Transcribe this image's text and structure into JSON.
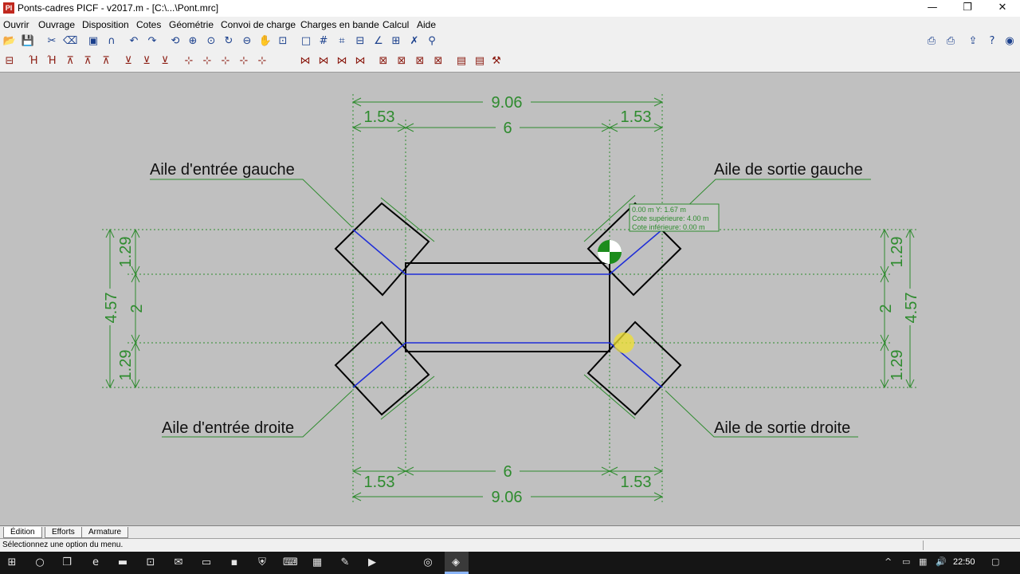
{
  "window": {
    "title": "Ponts-cadres PICF - v2017.m - [C:\\...\\Pont.mrc]",
    "app_icon": "PI",
    "minimize_glyph": "—",
    "restore_glyph": "❐",
    "close_glyph": "✕"
  },
  "menu": [
    "Ouvrir",
    "Ouvrage",
    "Disposition",
    "Cotes",
    "Géométrie",
    "Convoi de charge",
    "Charges en bande",
    "Calcul",
    "Aide"
  ],
  "toolbar1": [
    {
      "name": "open-folder-icon",
      "glyph": "📂"
    },
    {
      "name": "save-icon",
      "glyph": "💾"
    },
    {
      "name": "cut-icon",
      "glyph": "✂"
    },
    {
      "name": "erase-icon",
      "glyph": "⌫"
    },
    {
      "name": "properties-icon",
      "glyph": "▣"
    },
    {
      "name": "magnet-icon",
      "glyph": "∩"
    },
    {
      "name": "undo-icon",
      "glyph": "↶"
    },
    {
      "name": "redo-icon",
      "glyph": "↷"
    },
    {
      "name": "zoom-previous-icon",
      "glyph": "⟲"
    },
    {
      "name": "zoom-window-icon",
      "glyph": "⊕"
    },
    {
      "name": "zoom-in-icon",
      "glyph": "⊙"
    },
    {
      "name": "zoom-refresh-icon",
      "glyph": "↻"
    },
    {
      "name": "zoom-out-icon",
      "glyph": "⊖"
    },
    {
      "name": "pan-hand-icon",
      "glyph": "✋"
    },
    {
      "name": "zoom-extents-icon",
      "glyph": "⊡"
    },
    {
      "name": "frame-icon",
      "glyph": "□"
    },
    {
      "name": "grid-icon",
      "glyph": "#"
    },
    {
      "name": "snap-icon",
      "glyph": "⌗"
    },
    {
      "name": "dimension-icon",
      "glyph": "⊟"
    },
    {
      "name": "angle-icon",
      "glyph": "∠"
    },
    {
      "name": "layout-icon",
      "glyph": "⊞"
    },
    {
      "name": "tools-icon",
      "glyph": "✗"
    },
    {
      "name": "binoculars-icon",
      "glyph": "⚲"
    }
  ],
  "toolbar1_right": [
    {
      "name": "print-preview-icon",
      "glyph": "⎙"
    },
    {
      "name": "print-icon",
      "glyph": "⎙"
    },
    {
      "name": "export-icon",
      "glyph": "⇪"
    },
    {
      "name": "help-icon",
      "glyph": "?"
    },
    {
      "name": "web-icon",
      "glyph": "◉"
    }
  ],
  "toolbar2": [
    "⊟",
    "Ή",
    "Ή",
    "⊼",
    "⊼",
    "⊼",
    "⊻",
    "⊻",
    "⊻",
    "⊹",
    "⊹",
    "⊹",
    "⊹",
    "⊹",
    "⋈",
    "⋈",
    "⋈",
    "⋈",
    "⊠",
    "⊠",
    "⊠",
    "⊠",
    "▤",
    "▤",
    "⚒"
  ],
  "drawing": {
    "colors": {
      "dimension": "#2e8b2e",
      "outline": "#000000",
      "axis": "#1f2ed8",
      "marker": "#f0e030",
      "label_line": "#2e8b2e"
    },
    "dimensions": {
      "top_total": "9.06",
      "top_middle": "6",
      "top_left": "1.53",
      "top_right": "1.53",
      "bottom_total": "9.06",
      "bottom_middle": "6",
      "bottom_left": "1.53",
      "bottom_right": "1.53",
      "left_total": "4.57",
      "left_top": "1.29",
      "left_middle": "2",
      "left_bottom": "1.29",
      "right_total": "4.57",
      "right_top": "1.29",
      "right_middle": "2",
      "right_bottom": "1.29"
    },
    "labels": {
      "top_left": "Aile d'entrée gauche",
      "top_right": "Aile de sortie gauche",
      "bottom_left": "Aile d'entrée droite",
      "bottom_right": "Aile de sortie droite"
    },
    "tooltip": {
      "line1": "0.00 m  Y: 1.67 m",
      "line2": "Cote supérieure: 4.00 m",
      "line3": "Cote inférieure: 0.00 m"
    }
  },
  "tabs": [
    "Édition",
    "Efforts",
    "Armature"
  ],
  "status": {
    "message": "Sélectionnez une option du menu."
  },
  "taskbar": {
    "icons": [
      {
        "name": "windows-start-icon",
        "glyph": "⊞"
      },
      {
        "name": "cortana-search-icon",
        "glyph": "○"
      },
      {
        "name": "task-view-icon",
        "glyph": "❐"
      },
      {
        "name": "edge-browser-icon",
        "glyph": "e"
      },
      {
        "name": "file-explorer-icon",
        "glyph": "▬"
      },
      {
        "name": "store-icon",
        "glyph": "⊡"
      },
      {
        "name": "mail-icon",
        "glyph": "✉"
      },
      {
        "name": "remote-desktop-icon",
        "glyph": "▭"
      },
      {
        "name": "command-prompt-icon",
        "glyph": "▪"
      },
      {
        "name": "defender-shield-icon",
        "glyph": "⛨"
      },
      {
        "name": "keyboard-icon",
        "glyph": "⌨"
      },
      {
        "name": "calculator-icon",
        "glyph": "▦"
      },
      {
        "name": "paint-icon",
        "glyph": "✎"
      },
      {
        "name": "media-player-icon",
        "glyph": "▶"
      },
      {
        "name": "record-icon",
        "glyph": "◎"
      },
      {
        "name": "picf-app-icon",
        "glyph": "◈"
      }
    ],
    "tray": {
      "chevron": "^",
      "battery": "▭",
      "network": "▦",
      "volume": "🔊",
      "keyboard": "⌨"
    },
    "clock": "22:50",
    "notification_glyph": "▢"
  }
}
